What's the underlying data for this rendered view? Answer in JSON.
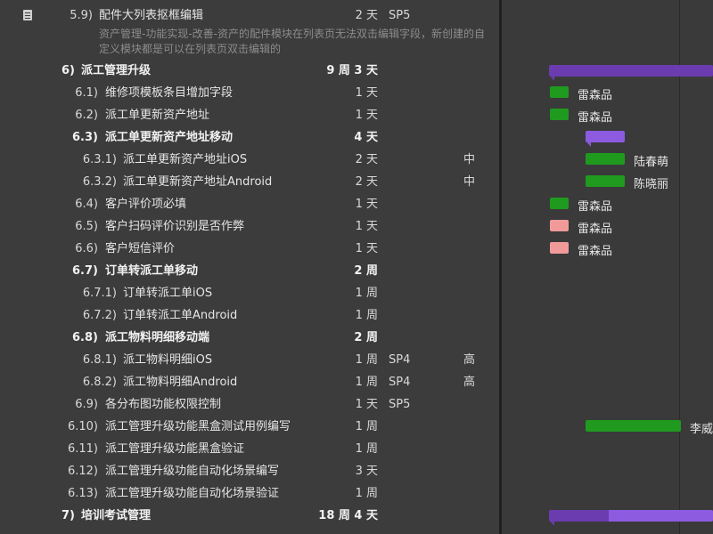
{
  "tasks": [
    {
      "num": "5.9)",
      "title": "配件大列表抠框编辑",
      "duration": "2 天",
      "tag": "SP5",
      "priority": "",
      "bold": false
    },
    {
      "num": "6)",
      "title": "派工管理升级",
      "duration": "9 周 3 天",
      "tag": "",
      "priority": "",
      "bold": true
    },
    {
      "num": "6.1)",
      "title": "维修项模板条目增加字段",
      "duration": "1 天",
      "tag": "",
      "priority": "",
      "bold": false
    },
    {
      "num": "6.2)",
      "title": "派工单更新资产地址",
      "duration": "1 天",
      "tag": "",
      "priority": "",
      "bold": false
    },
    {
      "num": "6.3)",
      "title": "派工单更新资产地址移动",
      "duration": "4 天",
      "tag": "",
      "priority": "",
      "bold": true
    },
    {
      "num": "6.3.1)",
      "title": "派工单更新资产地址iOS",
      "duration": "2 天",
      "tag": "",
      "priority": "中",
      "bold": false
    },
    {
      "num": "6.3.2)",
      "title": "派工单更新资产地址Android",
      "duration": "2 天",
      "tag": "",
      "priority": "中",
      "bold": false
    },
    {
      "num": "6.4)",
      "title": "客户评价项必填",
      "duration": "1 天",
      "tag": "",
      "priority": "",
      "bold": false
    },
    {
      "num": "6.5)",
      "title": "客户扫码评价识别是否作弊",
      "duration": "1 天",
      "tag": "",
      "priority": "",
      "bold": false
    },
    {
      "num": "6.6)",
      "title": "客户短信评价",
      "duration": "1 天",
      "tag": "",
      "priority": "",
      "bold": false
    },
    {
      "num": "6.7)",
      "title": "订单转派工单移动",
      "duration": "2 周",
      "tag": "",
      "priority": "",
      "bold": true
    },
    {
      "num": "6.7.1)",
      "title": "订单转派工单iOS",
      "duration": "1 周",
      "tag": "",
      "priority": "",
      "bold": false
    },
    {
      "num": "6.7.2)",
      "title": "订单转派工单Android",
      "duration": "1 周",
      "tag": "",
      "priority": "",
      "bold": false
    },
    {
      "num": "6.8)",
      "title": "派工物料明细移动端",
      "duration": "2 周",
      "tag": "",
      "priority": "",
      "bold": true
    },
    {
      "num": "6.8.1)",
      "title": "派工物料明细iOS",
      "duration": "1 周",
      "tag": "SP4",
      "priority": "高",
      "bold": false
    },
    {
      "num": "6.8.2)",
      "title": "派工物料明细Android",
      "duration": "1 周",
      "tag": "SP4",
      "priority": "高",
      "bold": false
    },
    {
      "num": "6.9)",
      "title": "各分布图功能权限控制",
      "duration": "1 天",
      "tag": "SP5",
      "priority": "",
      "bold": false
    },
    {
      "num": "6.10)",
      "title": "派工管理升级功能黑盒测试用例编写",
      "duration": "1 周",
      "tag": "",
      "priority": "",
      "bold": false
    },
    {
      "num": "6.11)",
      "title": "派工管理升级功能黑盒验证",
      "duration": "1 周",
      "tag": "",
      "priority": "",
      "bold": false
    },
    {
      "num": "6.12)",
      "title": "派工管理升级功能自动化场景编写",
      "duration": "3 天",
      "tag": "",
      "priority": "",
      "bold": false
    },
    {
      "num": "6.13)",
      "title": "派工管理升级功能自动化场景验证",
      "duration": "1 周",
      "tag": "",
      "priority": "",
      "bold": false
    },
    {
      "num": "7)",
      "title": "培训考试管理",
      "duration": "18 周 4 天",
      "tag": "",
      "priority": "",
      "bold": true
    }
  ],
  "note": "资产管理-功能实现-改善-资产的配件模块在列表页无法双击编辑字段，新创建的自定义模块都是可以在列表页双击编辑的",
  "gantt_labels": [
    "雷森品",
    "雷森品",
    "陆春萌",
    "陈晓丽",
    "雷森品",
    "雷森品",
    "雷森品",
    "李威"
  ],
  "colors": {
    "done": "#1f9a1f",
    "late": "#f19a9a",
    "summary": "#6a3cb0",
    "summary_progress": "#8c5be0"
  }
}
